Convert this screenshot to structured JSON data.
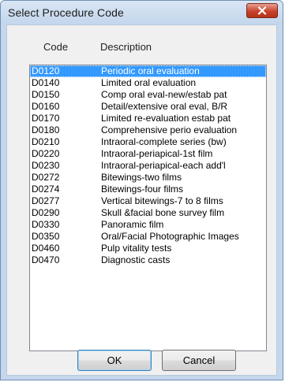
{
  "window": {
    "title": "Select Procedure Code"
  },
  "list": {
    "headers": {
      "code": "Code",
      "description": "Description"
    },
    "selected_index": 0,
    "items": [
      {
        "code": "D0120",
        "description": "Periodic oral evaluation"
      },
      {
        "code": "D0140",
        "description": "Limited oral evaluation"
      },
      {
        "code": "D0150",
        "description": "Comp oral eval-new/estab pat"
      },
      {
        "code": "D0160",
        "description": "Detail/extensive oral eval, B/R"
      },
      {
        "code": "D0170",
        "description": "Limited re-evaluation estab pat"
      },
      {
        "code": "D0180",
        "description": "Comprehensive perio evaluation"
      },
      {
        "code": "D0210",
        "description": "Intraoral-complete series (bw)"
      },
      {
        "code": "D0220",
        "description": "Intraoral-periapical-1st film"
      },
      {
        "code": "D0230",
        "description": "Intraoral-periapical-each add'l"
      },
      {
        "code": "D0272",
        "description": "Bitewings-two films"
      },
      {
        "code": "D0274",
        "description": "Bitewings-four films"
      },
      {
        "code": "D0277",
        "description": "Vertical bitewings-7 to 8 films"
      },
      {
        "code": "D0290",
        "description": "Skull &facial bone survey film"
      },
      {
        "code": "D0330",
        "description": "Panoramic film"
      },
      {
        "code": "D0350",
        "description": "Oral/Facial Photographic Images"
      },
      {
        "code": "D0460",
        "description": "Pulp vitality tests"
      },
      {
        "code": "D0470",
        "description": "Diagnostic casts"
      }
    ]
  },
  "buttons": {
    "ok": "OK",
    "cancel": "Cancel"
  },
  "icons": {
    "close": "close-icon"
  },
  "colors": {
    "selection": "#3399ff",
    "close_button": "#c7432d"
  }
}
